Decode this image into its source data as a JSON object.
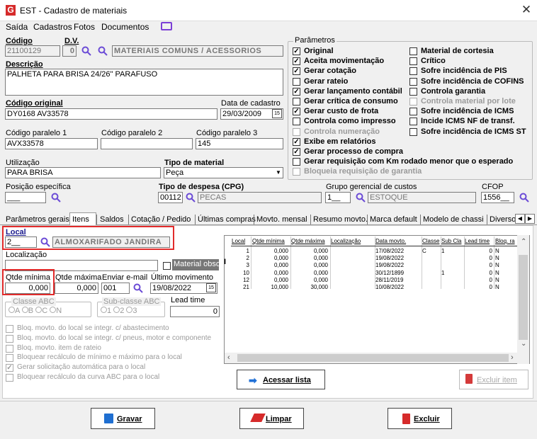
{
  "window": {
    "title": "EST - Cadastro de materiais",
    "close": "✕",
    "icon": "G"
  },
  "menu": [
    "Saída",
    "Cadastros",
    "Fotos",
    "Documentos"
  ],
  "header": {
    "codigo_label": "Código",
    "dv_label": "D.V.",
    "codigo": "21100129",
    "dv": "0",
    "classe": "MATERIAIS COMUNS / ACESSORIOS",
    "descricao_label": "Descrição",
    "descricao": "PALHETA PARA BRISA 24/26\" PARAFUSO",
    "codigo_original_label": "Código original",
    "codigo_original": "DY0168 AV33578",
    "data_cadastro_label": "Data de cadastro",
    "data_cadastro": "29/03/2009",
    "paralelo1_label": "Código paralelo 1",
    "paralelo1": "AVX33578",
    "paralelo2_label": "Código paralelo 2",
    "paralelo2": "",
    "paralelo3_label": "Código paralelo 3",
    "paralelo3": "145",
    "utilizacao_label": "Utilização",
    "utilizacao": "PARA BRISA",
    "tipo_material_label": "Tipo de material",
    "tipo_material": "Peça",
    "posicao_label": "Posição específica",
    "posicao": "___",
    "tipo_despesa_label": "Tipo de despesa (CPG)",
    "tipo_despesa_cod": "00112",
    "tipo_despesa": "PECAS",
    "grupo_label": "Grupo gerencial de custos",
    "grupo_cod": "1__",
    "grupo": "ESTOQUE",
    "cfop_label": "CFOP",
    "cfop": "1556__"
  },
  "parametros": {
    "title": "Parâmetros",
    "left": [
      {
        "label": "Original",
        "checked": true,
        "enabled": true
      },
      {
        "label": "Aceita movimentação",
        "checked": true,
        "enabled": true
      },
      {
        "label": "Gerar cotação",
        "checked": true,
        "enabled": true
      },
      {
        "label": "Gerar rateio",
        "checked": false,
        "enabled": true
      },
      {
        "label": "Gerar lançamento contábil",
        "checked": true,
        "enabled": true
      },
      {
        "label": "Gerar crítica de consumo",
        "checked": false,
        "enabled": true
      },
      {
        "label": "Gerar custo de frota",
        "checked": true,
        "enabled": true
      },
      {
        "label": "Controla como impresso",
        "checked": false,
        "enabled": true
      },
      {
        "label": "Controla numeração",
        "checked": false,
        "enabled": false
      },
      {
        "label": "Exibe em relatórios",
        "checked": true,
        "enabled": true
      },
      {
        "label": "Gerar processo de compra",
        "checked": true,
        "enabled": true
      },
      {
        "label": "Gerar requisição com Km rodado menor que o esperado",
        "checked": false,
        "enabled": true
      },
      {
        "label": "Bloqueia requisição de garantia",
        "checked": false,
        "enabled": false
      }
    ],
    "right": [
      {
        "label": "Material de cortesia",
        "checked": false,
        "enabled": true
      },
      {
        "label": "Crítico",
        "checked": false,
        "enabled": true
      },
      {
        "label": "Sofre incidência de PIS",
        "checked": false,
        "enabled": true
      },
      {
        "label": "Sofre incidência de COFINS",
        "checked": false,
        "enabled": true
      },
      {
        "label": "Controla garantia",
        "checked": false,
        "enabled": true
      },
      {
        "label": "Controla material por lote",
        "checked": false,
        "enabled": false
      },
      {
        "label": "Sofre incidência de ICMS",
        "checked": false,
        "enabled": true
      },
      {
        "label": "Incide ICMS NF de transf.",
        "checked": false,
        "enabled": true
      },
      {
        "label": "Sofre incidência de ICMS ST",
        "checked": false,
        "enabled": true
      }
    ]
  },
  "tabs": [
    "Parâmetros gerais",
    "Itens",
    "Saldos",
    "Cotação / Pedido",
    "Últimas compras",
    "Movto. mensal",
    "Resumo movto.",
    "Marca default",
    "Modelo de chassi",
    "Diverso"
  ],
  "itens": {
    "local_label": "Local",
    "local_cod": "2__",
    "local": "ALMOXARIFADO JANDIRA",
    "localizacao_label": "Localização",
    "localizacao": "",
    "obsoleto_label": "Material obsoleto",
    "qtde_min_label": "Qtde mínima",
    "qtde_min": "0,000",
    "qtde_max_label": "Qtde máxima",
    "qtde_max": "0,000",
    "email_label": "Enviar e-mail",
    "email": "001",
    "ultimo_mov_label": "Último movimento",
    "ultimo_mov": "19/08/2022",
    "classe_abc_label": "Classe ABC",
    "classe_opts": [
      "A",
      "B",
      "C",
      "N"
    ],
    "subclasse_label": "Sub-classe ABC",
    "subclasse_opts": [
      "1",
      "2",
      "3"
    ],
    "lead_label": "Lead time",
    "lead": "0",
    "bloq": [
      {
        "label": "Bloq. movto. do local se integr. c/ abastecimento",
        "checked": false
      },
      {
        "label": "Bloq. movto. do local se integr. c/ pneus, motor e componente",
        "checked": false
      },
      {
        "label": "Bloq. movto. item de rateio",
        "checked": false
      },
      {
        "label": "Bloquear recálculo de mínimo e máximo para o local",
        "checked": false
      },
      {
        "label": "Gerar solicitação automática para o local",
        "checked": true
      },
      {
        "label": "Bloquear recálculo da curva ABC para o local",
        "checked": false
      }
    ],
    "grid": {
      "headers": [
        "Local",
        "Qtde mínima",
        "Qtde máxima",
        "Localização",
        "Data movto.",
        "Classe",
        "Sub Cla",
        "Lead time",
        "Bloq. ra"
      ],
      "rows": [
        [
          "1",
          "0,000",
          "0,000",
          "",
          "17/08/2022",
          "C",
          "1",
          "0",
          "N"
        ],
        [
          "2",
          "0,000",
          "0,000",
          "",
          "19/08/2022",
          "",
          "",
          "0",
          "N"
        ],
        [
          "3",
          "0,000",
          "0,000",
          "",
          "19/08/2022",
          "",
          "",
          "0",
          "N"
        ],
        [
          "10",
          "0,000",
          "0,000",
          "",
          "30/12/1899",
          "",
          "1",
          "0",
          "N"
        ],
        [
          "12",
          "0,000",
          "0,000",
          "",
          "28/11/2019",
          "",
          "",
          "0",
          "N"
        ],
        [
          "21",
          "10,000",
          "30,000",
          "",
          "10/08/2022",
          "",
          "",
          "0",
          "N"
        ]
      ]
    },
    "acessar_label": "Acessar lista",
    "excluir_item_label": "Excluir item"
  },
  "footer": {
    "gravar": "Gravar",
    "limpar": "Limpar",
    "excluir": "Excluir"
  },
  "colors": {
    "accent": "#6b4bd6",
    "red": "#e12b2b"
  }
}
